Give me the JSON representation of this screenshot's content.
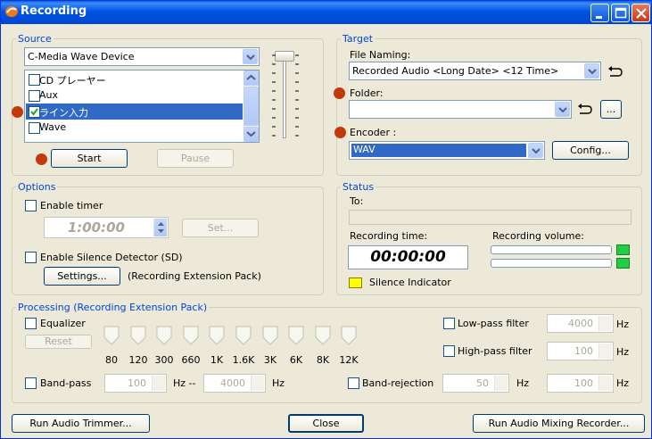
{
  "window": {
    "title": "Recording"
  },
  "source": {
    "legend": "Source",
    "device": "C-Media Wave Device",
    "items": [
      {
        "label": "CD プレーヤー",
        "checked": false
      },
      {
        "label": "Aux",
        "checked": false
      },
      {
        "label": "ライン入力",
        "checked": true
      },
      {
        "label": "Wave",
        "checked": false
      }
    ],
    "start_label": "Start",
    "pause_label": "Pause"
  },
  "target": {
    "legend": "Target",
    "file_naming_label": "File Naming:",
    "file_naming_value": "Recorded Audio <Long Date> <12 Time>",
    "folder_label": "Folder:",
    "folder_value": "",
    "browse_label": "...",
    "encoder_label": "Encoder :",
    "encoder_value": "WAV",
    "config_label": "Config..."
  },
  "options": {
    "legend": "Options",
    "enable_timer_label": "Enable timer",
    "timer_value": "1:00:00",
    "set_label": "Set...",
    "silence_label": "Enable Silence Detector (SD)",
    "settings_label": "Settings...",
    "extension_note": "(Recording Extension Pack)"
  },
  "status": {
    "legend": "Status",
    "to_label": "To:",
    "to_value": "",
    "recording_time_label": "Recording time:",
    "recording_time_value": "00:00:00",
    "recording_volume_label": "Recording volume:",
    "silence_indicator_label": "Silence Indicator",
    "colors": {
      "silence": "#ffff00",
      "volume_ok": "#22cc44"
    }
  },
  "processing": {
    "legend": "Processing (Recording Extension Pack)",
    "equalizer_label": "Equalizer",
    "reset_label": "Reset",
    "bands": [
      "80",
      "120",
      "300",
      "660",
      "1K",
      "1.6K",
      "3K",
      "6K",
      "8K",
      "12K"
    ],
    "lowpass_label": "Low-pass filter",
    "lowpass_value": "4000",
    "highpass_label": "High-pass filter",
    "highpass_value": "100",
    "bandpass_label": "Band-pass",
    "bandpass_from": "100",
    "bandpass_sep": "Hz --",
    "bandpass_to": "4000",
    "bandrej_label": "Band-rejection",
    "bandrej_from": "50",
    "bandrej_to": "100",
    "hz": "Hz"
  },
  "footer": {
    "trimmer_label": "Run Audio Trimmer...",
    "close_label": "Close",
    "mixing_label": "Run Audio Mixing Recorder..."
  }
}
